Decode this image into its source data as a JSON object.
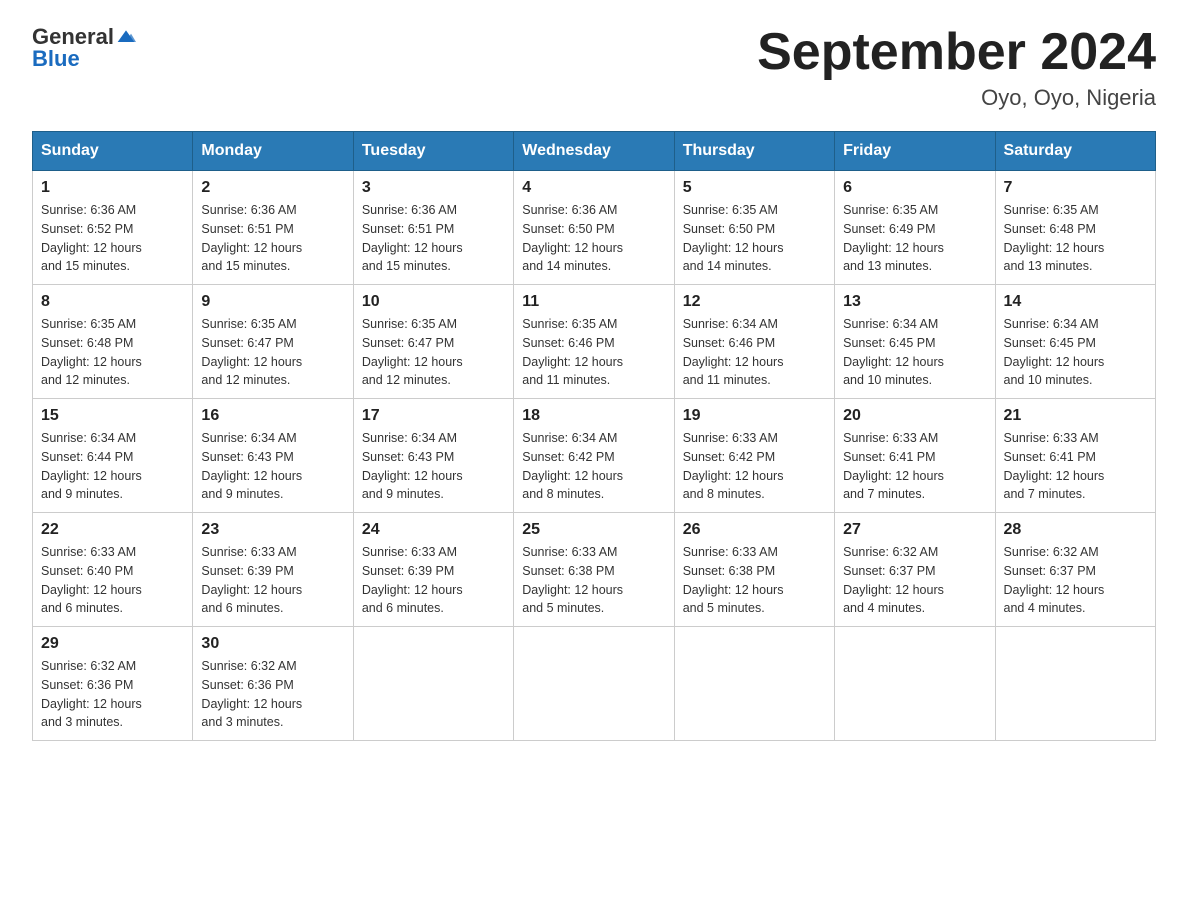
{
  "logo": {
    "text_general": "General",
    "text_blue": "Blue"
  },
  "title": "September 2024",
  "subtitle": "Oyo, Oyo, Nigeria",
  "days_of_week": [
    "Sunday",
    "Monday",
    "Tuesday",
    "Wednesday",
    "Thursday",
    "Friday",
    "Saturday"
  ],
  "weeks": [
    [
      {
        "day": "1",
        "sunrise": "6:36 AM",
        "sunset": "6:52 PM",
        "daylight": "12 hours and 15 minutes."
      },
      {
        "day": "2",
        "sunrise": "6:36 AM",
        "sunset": "6:51 PM",
        "daylight": "12 hours and 15 minutes."
      },
      {
        "day": "3",
        "sunrise": "6:36 AM",
        "sunset": "6:51 PM",
        "daylight": "12 hours and 15 minutes."
      },
      {
        "day": "4",
        "sunrise": "6:36 AM",
        "sunset": "6:50 PM",
        "daylight": "12 hours and 14 minutes."
      },
      {
        "day": "5",
        "sunrise": "6:35 AM",
        "sunset": "6:50 PM",
        "daylight": "12 hours and 14 minutes."
      },
      {
        "day": "6",
        "sunrise": "6:35 AM",
        "sunset": "6:49 PM",
        "daylight": "12 hours and 13 minutes."
      },
      {
        "day": "7",
        "sunrise": "6:35 AM",
        "sunset": "6:48 PM",
        "daylight": "12 hours and 13 minutes."
      }
    ],
    [
      {
        "day": "8",
        "sunrise": "6:35 AM",
        "sunset": "6:48 PM",
        "daylight": "12 hours and 12 minutes."
      },
      {
        "day": "9",
        "sunrise": "6:35 AM",
        "sunset": "6:47 PM",
        "daylight": "12 hours and 12 minutes."
      },
      {
        "day": "10",
        "sunrise": "6:35 AM",
        "sunset": "6:47 PM",
        "daylight": "12 hours and 12 minutes."
      },
      {
        "day": "11",
        "sunrise": "6:35 AM",
        "sunset": "6:46 PM",
        "daylight": "12 hours and 11 minutes."
      },
      {
        "day": "12",
        "sunrise": "6:34 AM",
        "sunset": "6:46 PM",
        "daylight": "12 hours and 11 minutes."
      },
      {
        "day": "13",
        "sunrise": "6:34 AM",
        "sunset": "6:45 PM",
        "daylight": "12 hours and 10 minutes."
      },
      {
        "day": "14",
        "sunrise": "6:34 AM",
        "sunset": "6:45 PM",
        "daylight": "12 hours and 10 minutes."
      }
    ],
    [
      {
        "day": "15",
        "sunrise": "6:34 AM",
        "sunset": "6:44 PM",
        "daylight": "12 hours and 9 minutes."
      },
      {
        "day": "16",
        "sunrise": "6:34 AM",
        "sunset": "6:43 PM",
        "daylight": "12 hours and 9 minutes."
      },
      {
        "day": "17",
        "sunrise": "6:34 AM",
        "sunset": "6:43 PM",
        "daylight": "12 hours and 9 minutes."
      },
      {
        "day": "18",
        "sunrise": "6:34 AM",
        "sunset": "6:42 PM",
        "daylight": "12 hours and 8 minutes."
      },
      {
        "day": "19",
        "sunrise": "6:33 AM",
        "sunset": "6:42 PM",
        "daylight": "12 hours and 8 minutes."
      },
      {
        "day": "20",
        "sunrise": "6:33 AM",
        "sunset": "6:41 PM",
        "daylight": "12 hours and 7 minutes."
      },
      {
        "day": "21",
        "sunrise": "6:33 AM",
        "sunset": "6:41 PM",
        "daylight": "12 hours and 7 minutes."
      }
    ],
    [
      {
        "day": "22",
        "sunrise": "6:33 AM",
        "sunset": "6:40 PM",
        "daylight": "12 hours and 6 minutes."
      },
      {
        "day": "23",
        "sunrise": "6:33 AM",
        "sunset": "6:39 PM",
        "daylight": "12 hours and 6 minutes."
      },
      {
        "day": "24",
        "sunrise": "6:33 AM",
        "sunset": "6:39 PM",
        "daylight": "12 hours and 6 minutes."
      },
      {
        "day": "25",
        "sunrise": "6:33 AM",
        "sunset": "6:38 PM",
        "daylight": "12 hours and 5 minutes."
      },
      {
        "day": "26",
        "sunrise": "6:33 AM",
        "sunset": "6:38 PM",
        "daylight": "12 hours and 5 minutes."
      },
      {
        "day": "27",
        "sunrise": "6:32 AM",
        "sunset": "6:37 PM",
        "daylight": "12 hours and 4 minutes."
      },
      {
        "day": "28",
        "sunrise": "6:32 AM",
        "sunset": "6:37 PM",
        "daylight": "12 hours and 4 minutes."
      }
    ],
    [
      {
        "day": "29",
        "sunrise": "6:32 AM",
        "sunset": "6:36 PM",
        "daylight": "12 hours and 3 minutes."
      },
      {
        "day": "30",
        "sunrise": "6:32 AM",
        "sunset": "6:36 PM",
        "daylight": "12 hours and 3 minutes."
      },
      null,
      null,
      null,
      null,
      null
    ]
  ],
  "labels": {
    "sunrise": "Sunrise:",
    "sunset": "Sunset:",
    "daylight": "Daylight:"
  }
}
